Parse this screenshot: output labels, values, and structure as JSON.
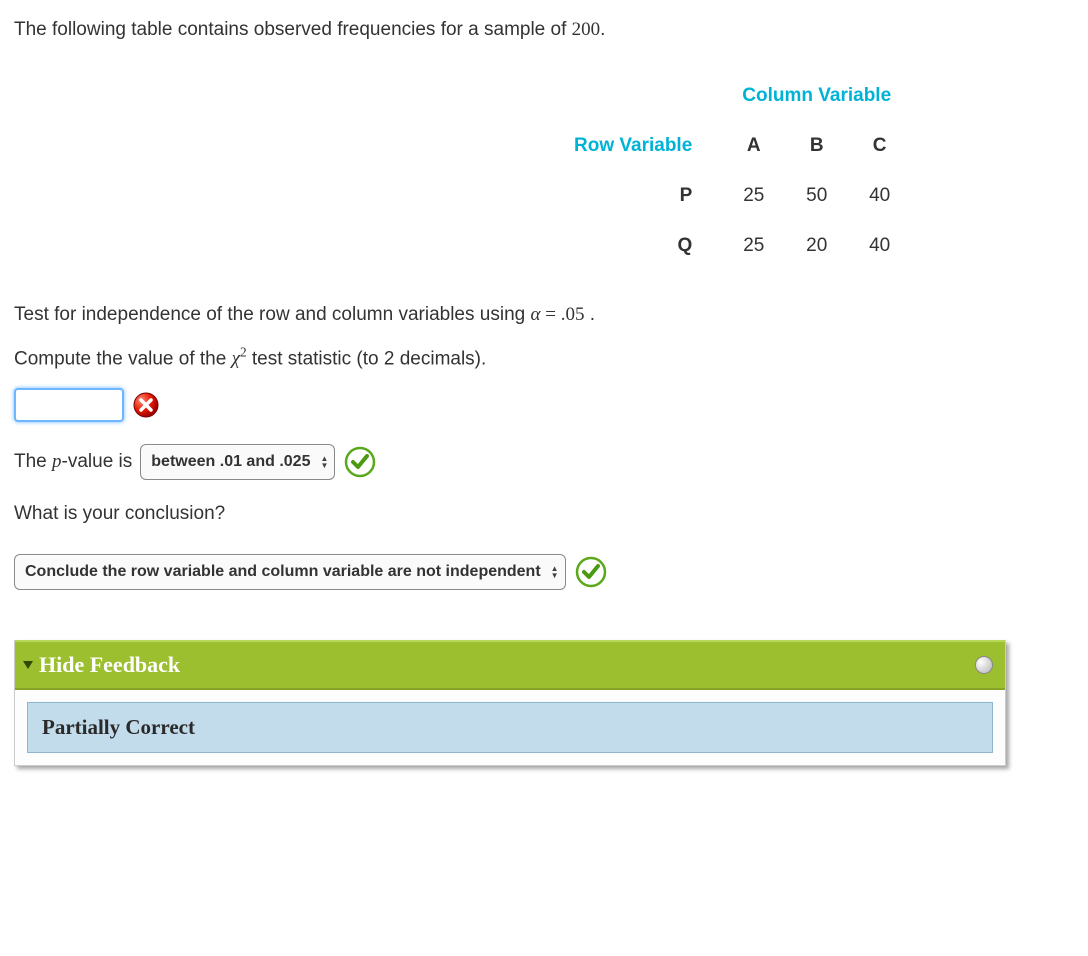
{
  "intro": {
    "prefix": "The following table contains observed frequencies for a sample of ",
    "n": "200",
    "suffix": "."
  },
  "table": {
    "column_header": "Column Variable",
    "row_header": "Row Variable",
    "cols": [
      "A",
      "B",
      "C"
    ],
    "rows": [
      {
        "label": "P",
        "vals": [
          "25",
          "50",
          "40"
        ]
      },
      {
        "label": "Q",
        "vals": [
          "25",
          "20",
          "40"
        ]
      }
    ]
  },
  "q1": {
    "prefix": "Test for independence of the row and column variables using ",
    "alpha_sym": "α",
    "eq": " = ",
    "alpha_val": ".05",
    "suffix": " ."
  },
  "q2": {
    "prefix": "Compute the value of the ",
    "chi": "χ",
    "sq": "2",
    "suffix": " test statistic (to 2 decimals)."
  },
  "input1": {
    "value": ""
  },
  "pvalue": {
    "prefix": "The ",
    "p": "p",
    "mid": "-value is",
    "selected": "between .01 and .025"
  },
  "conclusion_q": "What is your conclusion?",
  "conclusion_sel": "Conclude the row variable and column variable are not independent",
  "feedback": {
    "toggle": "Hide Feedback",
    "status": "Partially Correct"
  }
}
